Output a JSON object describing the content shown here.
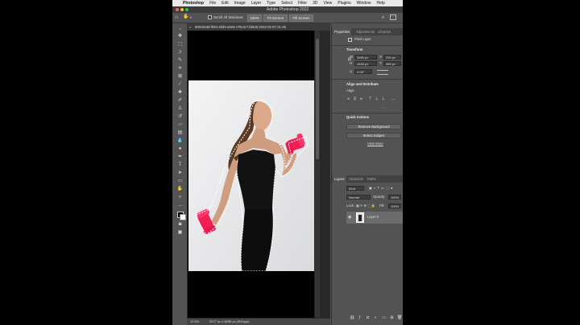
{
  "menubar": {
    "app_name": "Photoshop",
    "items": [
      "File",
      "Edit",
      "Image",
      "Layer",
      "Type",
      "Select",
      "Filter",
      "3D",
      "View",
      "Plugins",
      "Window",
      "Help"
    ]
  },
  "window": {
    "title": "Adobe Photoshop 2022"
  },
  "options_bar": {
    "scroll_all_windows": "Scroll All Windows",
    "zoom_100": "100%",
    "fit_screen": "Fit Screen",
    "fill_screen": "Fill Screen"
  },
  "document": {
    "tab_title": "900c8348-f594-4d46-a9e6-c79c2c71b8d3-2022-02-07-21-45",
    "zoom": "12.5%",
    "doc_info": "3377 px x 5096 px (300 ppi)"
  },
  "properties": {
    "tabs": [
      "Properties",
      "Adjustments",
      "Libraries"
    ],
    "layer_type": "Pixel Layer",
    "transform_label": "Transform",
    "w_label": "W",
    "w_value": "3065 px",
    "x_label": "X",
    "x_value": "209 px",
    "h_label": "H",
    "h_value": "4484 px",
    "y_label": "Y",
    "y_value": "980 px",
    "angle_value": "0.00°",
    "align_label": "Align and Distribute",
    "align_sub": "Align:",
    "quick_actions_label": "Quick Actions",
    "remove_bg": "Remove Background",
    "select_subject": "Select Subject",
    "view_more": "View More"
  },
  "layers_panel": {
    "tabs": [
      "Layers",
      "Channels",
      "Paths"
    ],
    "filter_kind": "Kind",
    "blend_mode": "Normal",
    "opacity_label": "Opacity:",
    "opacity_value": "100%",
    "lock_label": "Lock:",
    "fill_label": "Fill:",
    "fill_value": "100%",
    "layers": [
      {
        "name": "Layer 0"
      }
    ]
  },
  "colors": {
    "accent": "#ff2d55",
    "bg_panel": "#535353",
    "selection": "#ffffff"
  }
}
